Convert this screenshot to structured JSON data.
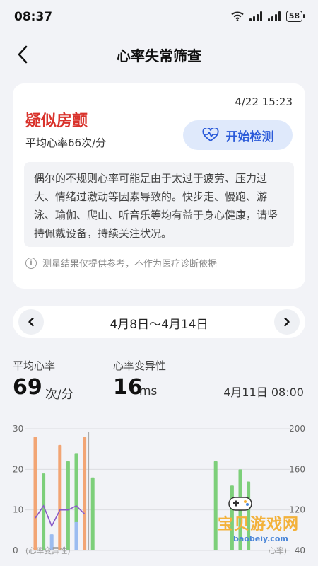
{
  "status_bar": {
    "time": "08:37",
    "battery": "58"
  },
  "header": {
    "title": "心率失常筛查"
  },
  "result_card": {
    "timestamp": "4/22 15:23",
    "result": "疑似房颤",
    "avg_heart_rate_text": "平均心率66次/分",
    "start_button_label": "开始检测",
    "advice_text": "偶尔的不规则心率可能是由于太过于疲劳、压力过大、情绪过激动等因素导致的。快步走、慢跑、游泳、瑜伽、爬山、听音乐等均有益于身心健康，请坚持佩戴设备，持续关注状况。",
    "disclaimer": "测量结果仅提供参考，不作为医疗诊断依据"
  },
  "date_range": {
    "label": "4月8日～4月14日"
  },
  "metrics": {
    "avg_hr_label": "平均心率",
    "avg_hr_value": "69",
    "avg_hr_unit": "次/分",
    "hrv_label": "心率变异性",
    "hrv_value": "16",
    "hrv_unit": "ms",
    "selected_time": "4月11日 08:00"
  },
  "watermark": {
    "text": "宝贝游戏网",
    "sub": "baobeiy.com"
  },
  "colors": {
    "accent_blue": "#2a5ad9",
    "alert_red": "#d9322b",
    "orange_bar": "#f2a574",
    "green_bar": "#7dcf7a",
    "blue_bar": "#9bbcf0",
    "line_purple": "#8a5ac8"
  },
  "chart_data": {
    "type": "bar",
    "left_axis": {
      "ticks": [
        "30",
        "20",
        "10",
        "0"
      ],
      "ylim": [
        0,
        30
      ],
      "label": "心率变异性"
    },
    "right_axis": {
      "ticks": [
        "200",
        "160",
        "120",
        "40"
      ],
      "label": "心率"
    },
    "series": [
      {
        "color": "orange",
        "axis": "left",
        "x": [
          1,
          4,
          7
        ],
        "values": [
          28,
          26,
          28
        ]
      },
      {
        "color": "green",
        "axis": "left",
        "x": [
          2,
          5,
          6,
          8,
          23,
          25,
          26,
          27
        ],
        "values": [
          19,
          22,
          24,
          18,
          22,
          16,
          20,
          17
        ]
      },
      {
        "color": "blue",
        "axis": "left",
        "x": [
          3,
          6
        ],
        "values": [
          4,
          7
        ]
      },
      {
        "color": "purple-line",
        "axis": "left",
        "x": [
          1,
          2,
          3,
          4,
          5,
          6,
          7
        ],
        "values": [
          8,
          11,
          6,
          10,
          10,
          11,
          9
        ]
      }
    ],
    "selected_x": 7.5,
    "grid": true
  }
}
